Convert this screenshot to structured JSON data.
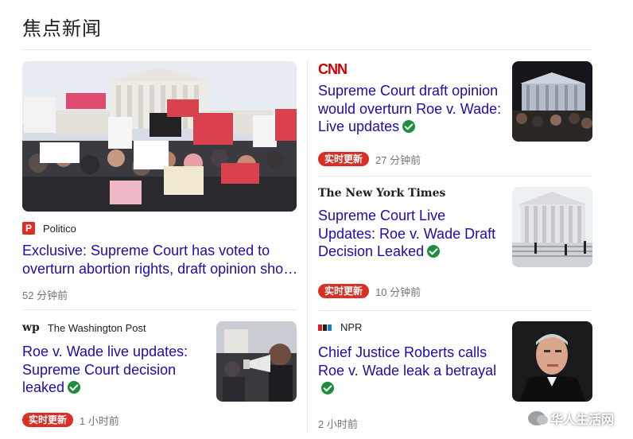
{
  "section": {
    "title": "焦点新闻"
  },
  "live_badge": "实时更新",
  "left": {
    "featured": {
      "source": "Politico",
      "source_logo_letter": "P",
      "headline_line1": "Exclusive: Supreme Court has voted to",
      "headline_line2": "overturn abortion rights, draft opinion sho…",
      "time": "52 分钟前"
    },
    "secondary": {
      "source": "The Washington Post",
      "source_logo": "wp",
      "headline_line1": "Roe v. Wade live updates:",
      "headline_line2": "Supreme Court decision",
      "headline_line3": "leaked",
      "time": "1 小时前"
    }
  },
  "right": {
    "items": [
      {
        "source_logo": "CNN",
        "headline_line1": "Supreme Court draft opinion",
        "headline_line2": "would overturn Roe v. Wade:",
        "headline_line3": "Live updates",
        "time": "27 分钟前"
      },
      {
        "source_logo": "The New York Times",
        "headline_line1": "Supreme Court Live",
        "headline_line2": "Updates: Roe v. Wade Draft",
        "headline_line3": "Decision Leaked",
        "time": "10 分钟前"
      },
      {
        "source": "NPR",
        "headline_line1": "Chief Justice Roberts calls",
        "headline_line2": "Roe v. Wade leak a betrayal",
        "time": "2 小时前"
      }
    ]
  },
  "watermark": "华人生活网",
  "colors": {
    "link": "#1a0dab",
    "live": "#d93025",
    "verified": "#1e8e3e",
    "cnn": "#cc0000"
  }
}
